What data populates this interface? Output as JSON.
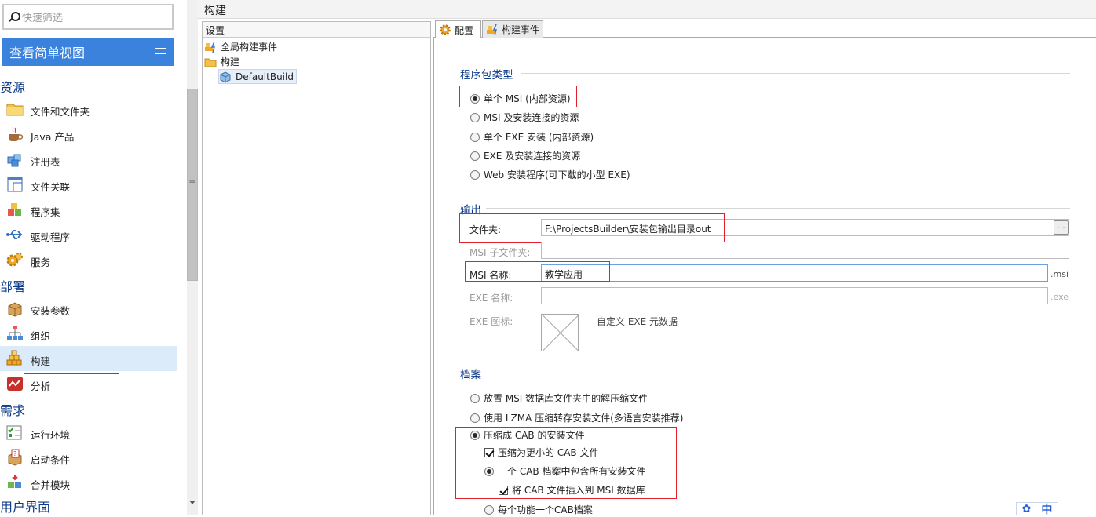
{
  "filter": {
    "placeholder": "快速筛选"
  },
  "simple_view_button": "查看简单视图",
  "sections": {
    "resources": "资源",
    "deploy": "部署",
    "requirements": "需求",
    "ui": "用户界面"
  },
  "nav": {
    "files": "文件和文件夹",
    "java": "Java 产品",
    "registry": "注册表",
    "file_assoc": "文件关联",
    "assemblies": "程序集",
    "drivers": "驱动程序",
    "services": "服务",
    "install_params": "安装参数",
    "organization": "组织",
    "build": "构建",
    "analysis": "分析",
    "runtime": "运行环境",
    "launch_conditions": "启动条件",
    "merge_modules": "合并模块"
  },
  "title": "构建",
  "settings": {
    "header": "设置",
    "global_events": "全局构建事件",
    "build_folder": "构建",
    "default_build": "DefaultBuild"
  },
  "tabs": {
    "config": "配置",
    "events": "构建事件"
  },
  "package_type": {
    "title": "程序包类型",
    "options": [
      "单个 MSI (内部资源)",
      "MSI 及安装连接的资源",
      "单个 EXE 安装 (内部资源)",
      "EXE 及安装连接的资源",
      "Web 安装程序(可下载的小型 EXE)"
    ],
    "selected": 0
  },
  "output": {
    "title": "输出",
    "folder_label": "文件夹:",
    "folder_value": "F:\\ProjectsBuilder\\安装包输出目录out",
    "browse": "...",
    "msi_subfolder_label": "MSI 子文件夹:",
    "msi_name_label": "MSI 名称:",
    "msi_name_value": "教学应用",
    "msi_suffix": ".msi",
    "exe_name_label": "EXE 名称:",
    "exe_suffix": ".exe",
    "exe_icon_label": "EXE 图标:",
    "exe_metadata": "自定义 EXE 元数据"
  },
  "archive": {
    "title": "档案",
    "opt1": "放置 MSI 数据库文件夹中的解压缩文件",
    "opt2": "使用 LZMA 压缩转存安装文件(多语言安装推荐)",
    "opt3": "压缩成 CAB 的安装文件",
    "check1": "压缩为更小的 CAB 文件",
    "sub1": "一个 CAB 档案中包含所有安装文件",
    "check2": "将 CAB 文件插入到 MSI 数据库",
    "sub2": "每个功能一个CAB档案"
  },
  "ime": {
    "label": "中"
  }
}
